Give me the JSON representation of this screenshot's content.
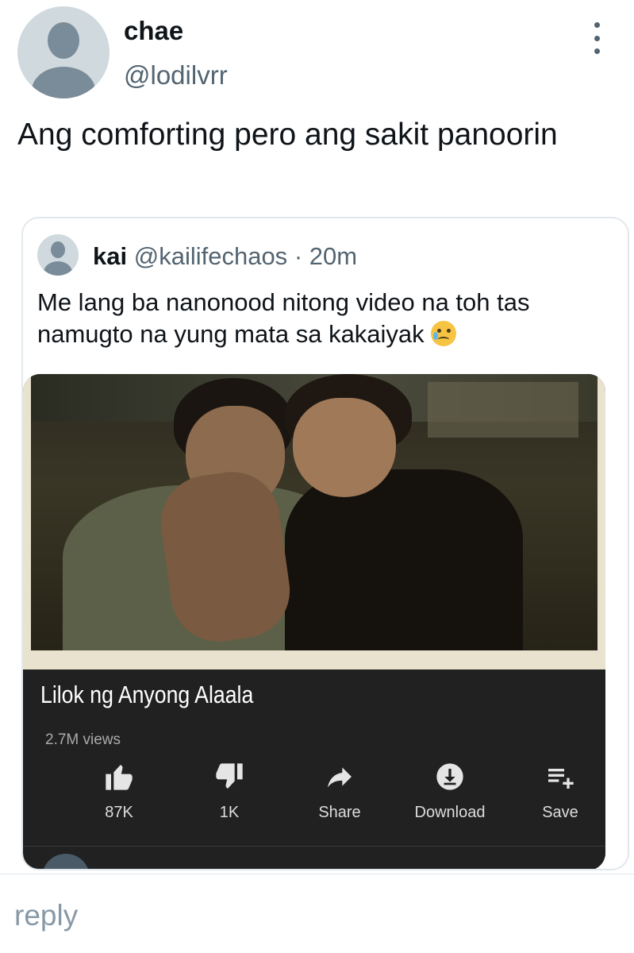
{
  "tweet": {
    "author_name": "chae",
    "author_handle": "@lodilvrr",
    "text": "Ang comforting pero ang sakit panoorin"
  },
  "quote": {
    "author_name": "kai",
    "author_handle": "@kailifechaos",
    "time": "· 20m",
    "text": "Me lang ba nanonood nitong video na toh tas namugto na yung mata sa kakaiyak",
    "emoji": "smiling-face-with-tear"
  },
  "video": {
    "title": "Lilok ng Anyong Alaala",
    "views": "2.7M views",
    "actions": [
      {
        "icon": "thumbs-up-icon",
        "label": "87K"
      },
      {
        "icon": "thumbs-down-icon",
        "label": "1K"
      },
      {
        "icon": "share-icon",
        "label": "Share"
      },
      {
        "icon": "download-icon",
        "label": "Download"
      },
      {
        "icon": "save-playlist-icon",
        "label": "Save"
      }
    ]
  },
  "compose": {
    "placeholder": "reply"
  },
  "colors": {
    "secondary_text": "#536471",
    "video_panel_bg": "#212121",
    "placeholder": "#8899a6"
  }
}
